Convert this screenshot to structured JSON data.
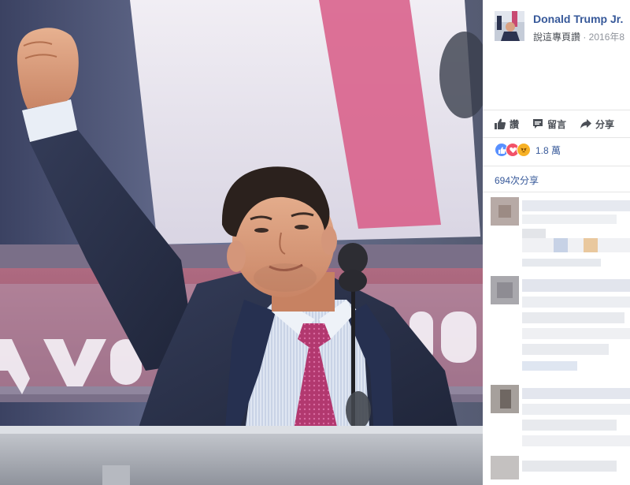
{
  "post": {
    "page_name": "Donald Trump Jr.",
    "say_label": "說這專頁讚",
    "date_text": " · 2016年8"
  },
  "actions": {
    "like_label": "讚",
    "comment_label": "留言",
    "share_label": "分享"
  },
  "reactions": {
    "count": "1.8 萬",
    "icons": [
      "like-icon",
      "love-icon",
      "angry-icon"
    ]
  },
  "shares": {
    "text": "694次分享"
  },
  "colors": {
    "link_blue": "#365899",
    "grey_text": "#90949c",
    "tie_pink": "#b63a78",
    "suit_navy": "#283049"
  }
}
